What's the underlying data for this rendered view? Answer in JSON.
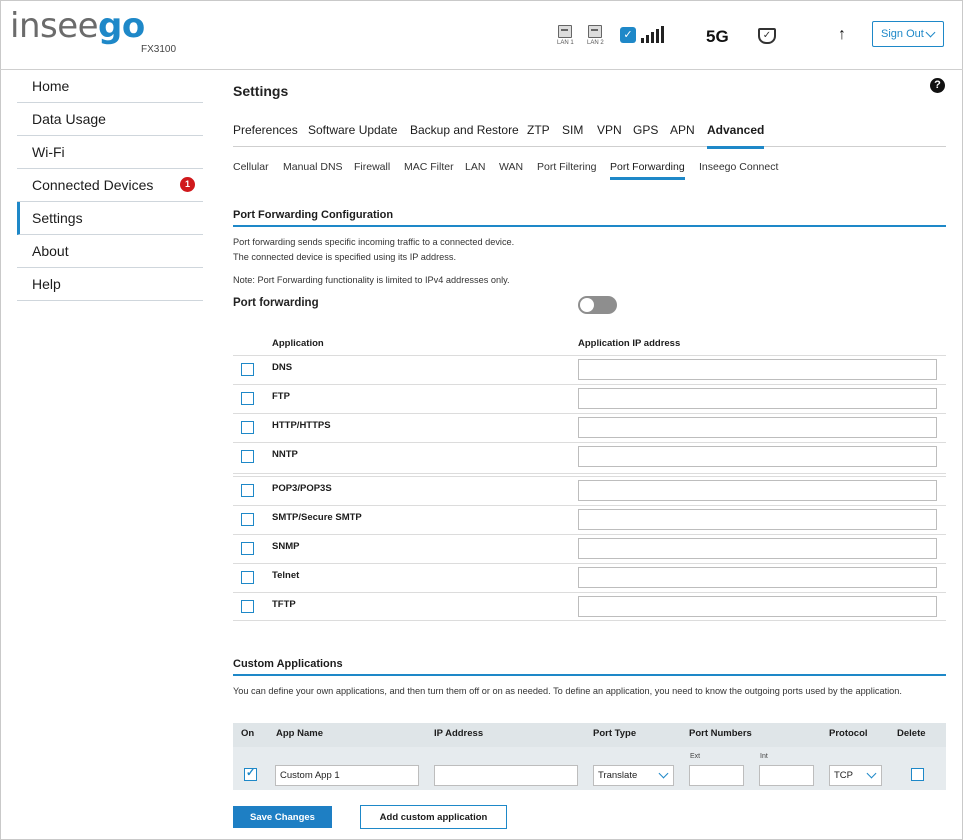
{
  "header": {
    "brand_light": "insee",
    "brand_bold": "go",
    "model": "FX3100",
    "lan1_label": "LAN 1",
    "lan2_label": "LAN 2",
    "network": "5G",
    "signout_label": "Sign Out"
  },
  "sidebar": {
    "items": [
      {
        "label": "Home"
      },
      {
        "label": "Data Usage"
      },
      {
        "label": "Wi-Fi"
      },
      {
        "label": "Connected Devices",
        "badge": "1"
      },
      {
        "label": "Settings",
        "active": true
      },
      {
        "label": "About"
      },
      {
        "label": "Help"
      }
    ]
  },
  "main": {
    "title": "Settings",
    "help_icon": "?",
    "tabs": [
      "Preferences",
      "Software Update",
      "Backup and Restore",
      "ZTP",
      "SIM",
      "VPN",
      "GPS",
      "APN",
      "Advanced"
    ],
    "active_tab": "Advanced",
    "subtabs": [
      "Cellular",
      "Manual DNS",
      "Firewall",
      "MAC Filter",
      "LAN",
      "WAN",
      "Port Filtering",
      "Port Forwarding",
      "Inseego Connect"
    ],
    "active_subtab": "Port Forwarding"
  },
  "port_forwarding": {
    "section_title": "Port Forwarding Configuration",
    "desc_line1": "Port forwarding sends specific incoming traffic to a connected device.",
    "desc_line2": "The connected device is specified using its IP address.",
    "note": "Note: Port Forwarding functionality is limited to IPv4 addresses only.",
    "toggle_label": "Port forwarding",
    "toggle_on": false,
    "col_application": "Application",
    "col_ip": "Application IP address",
    "apps": [
      {
        "name": "DNS",
        "checked": false,
        "ip": ""
      },
      {
        "name": "FTP",
        "checked": false,
        "ip": ""
      },
      {
        "name": "HTTP/HTTPS",
        "checked": false,
        "ip": ""
      },
      {
        "name": "NNTP",
        "checked": false,
        "ip": ""
      },
      {
        "name": "POP3/POP3S",
        "checked": false,
        "ip": ""
      },
      {
        "name": "SMTP/Secure SMTP",
        "checked": false,
        "ip": ""
      },
      {
        "name": "SNMP",
        "checked": false,
        "ip": ""
      },
      {
        "name": "Telnet",
        "checked": false,
        "ip": ""
      },
      {
        "name": "TFTP",
        "checked": false,
        "ip": ""
      }
    ]
  },
  "custom_apps": {
    "section_title": "Custom Applications",
    "desc": "You can define your own applications, and then turn them off or on as needed. To define an application, you need to know the outgoing ports used by the application.",
    "headers": {
      "on": "On",
      "app_name": "App Name",
      "ip": "IP Address",
      "port_type": "Port Type",
      "port_numbers": "Port Numbers",
      "ext": "Ext",
      "int": "Int",
      "protocol": "Protocol",
      "delete": "Delete"
    },
    "rows": [
      {
        "on": true,
        "app_name": "Custom App 1",
        "ip": "",
        "port_type": "Translate",
        "ext": "",
        "int": "",
        "protocol": "TCP",
        "delete": false
      }
    ]
  },
  "buttons": {
    "save": "Save Changes",
    "add": "Add custom application"
  },
  "colors": {
    "accent": "#1e88c8",
    "badge": "#d0191c",
    "toggle_off": "#8e8e8e"
  }
}
